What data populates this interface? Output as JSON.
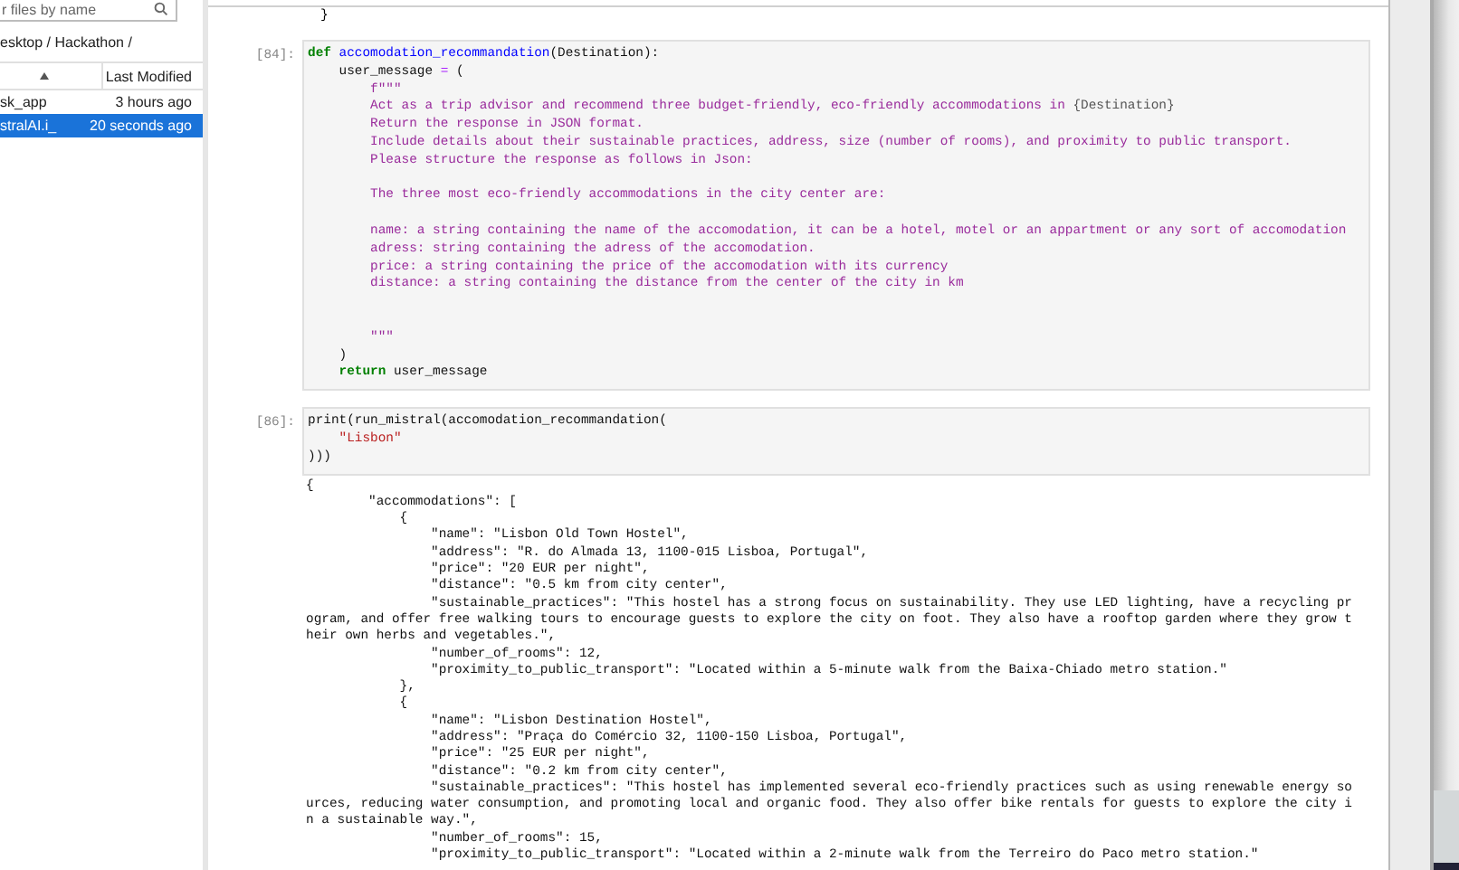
{
  "file_browser": {
    "search": {
      "placeholder": "r files by name"
    },
    "breadcrumb": "esktop / Hackathon /",
    "header": {
      "column_2": "Last Modified"
    },
    "files": [
      {
        "name": "sk_app",
        "modified": "3 hours ago",
        "selected": false
      },
      {
        "name": "stralAI.i_",
        "modified": "20 seconds ago",
        "selected": true
      }
    ]
  },
  "notebook": {
    "previous_output": [
      "}"
    ],
    "cells": [
      {
        "prompt": "[84]:",
        "lines": [
          {
            "kind": "code",
            "tokens": [
              {
                "kind": "keyword",
                "text": "def"
              },
              {
                "kind": "function",
                "text": " accomodation_recommandation"
              },
              {
                "kind": "plain",
                "text": "(Destination):"
              }
            ]
          },
          {
            "kind": "code",
            "tokens": [
              {
                "kind": "plain",
                "text": "    user_message "
              },
              {
                "kind": "operator",
                "text": "="
              },
              {
                "kind": "plain",
                "text": " ("
              }
            ]
          },
          {
            "kind": "code",
            "tokens": [
              {
                "kind": "docstring",
                "text": "        f\"\"\""
              }
            ]
          },
          {
            "kind": "code",
            "tokens": [
              {
                "kind": "docstring",
                "text": "        Act as a trip advisor and recommend three budget-friendly, eco-friendly accommodations in "
              },
              {
                "kind": "interp",
                "text": "{Destination}"
              }
            ]
          },
          {
            "kind": "code",
            "tokens": [
              {
                "kind": "docstring",
                "text": "        Return the response in JSON format."
              }
            ]
          },
          {
            "kind": "code",
            "tokens": [
              {
                "kind": "docstring",
                "text": "        Include details about their sustainable practices, address, size (number of rooms), and proximity to public transport."
              }
            ]
          },
          {
            "kind": "code",
            "tokens": [
              {
                "kind": "docstring",
                "text": "        Please structure the response as follows in Json:"
              }
            ]
          },
          {
            "kind": "blank"
          },
          {
            "kind": "code",
            "tokens": [
              {
                "kind": "docstring",
                "text": "        The three most eco-friendly accommodations in the city center are:"
              }
            ]
          },
          {
            "kind": "blank"
          },
          {
            "kind": "code",
            "tokens": [
              {
                "kind": "docstring",
                "text": "        name: a string containing the name of the accomodation, it can be a hotel, motel or an appartment or any sort of accomodation"
              }
            ]
          },
          {
            "kind": "code",
            "tokens": [
              {
                "kind": "docstring",
                "text": "        adress: string containing the adress of the accomodation."
              }
            ]
          },
          {
            "kind": "code",
            "tokens": [
              {
                "kind": "docstring",
                "text": "        price: a string containing the price of the accomodation with its currency"
              }
            ]
          },
          {
            "kind": "code",
            "tokens": [
              {
                "kind": "docstring",
                "text": "        distance: a string containing the distance from the center of the city in km"
              }
            ]
          },
          {
            "kind": "blank"
          },
          {
            "kind": "blank"
          },
          {
            "kind": "code",
            "tokens": [
              {
                "kind": "docstring",
                "text": "        \"\"\""
              }
            ]
          },
          {
            "kind": "code",
            "tokens": [
              {
                "kind": "plain",
                "text": "    )"
              }
            ]
          },
          {
            "kind": "code",
            "tokens": [
              {
                "kind": "keyword",
                "text": "    return"
              },
              {
                "kind": "plain",
                "text": " user_message"
              }
            ]
          }
        ]
      },
      {
        "prompt": "[86]:",
        "lines": [
          {
            "kind": "code",
            "tokens": [
              {
                "kind": "plain",
                "text": "print(run_mistral(accomodation_recommandation("
              }
            ]
          },
          {
            "kind": "code",
            "tokens": [
              {
                "kind": "string",
                "text": "    \"Lisbon\""
              }
            ]
          },
          {
            "kind": "code",
            "tokens": [
              {
                "kind": "plain",
                "text": ")))"
              }
            ]
          }
        ],
        "output": [
          "{",
          "        \"accommodations\": [",
          "            {",
          "                \"name\": \"Lisbon Old Town Hostel\",",
          "                \"address\": \"R. do Almada 13, 1100-015 Lisboa, Portugal\",",
          "                \"price\": \"20 EUR per night\",",
          "                \"distance\": \"0.5 km from city center\",",
          "                \"sustainable_practices\": \"This hostel has a strong focus on sustainability. They use LED lighting, have a recycling pr",
          "ogram, and offer free walking tours to encourage guests to explore the city on foot. They also have a rooftop garden where they grow t",
          "heir own herbs and vegetables.\",",
          "                \"number_of_rooms\": 12,",
          "                \"proximity_to_public_transport\": \"Located within a 5-minute walk from the Baixa-Chiado metro station.\"",
          "            },",
          "            {",
          "                \"name\": \"Lisbon Destination Hostel\",",
          "                \"address\": \"Praça do Comércio 32, 1100-150 Lisboa, Portugal\",",
          "                \"price\": \"25 EUR per night\",",
          "                \"distance\": \"0.2 km from city center\",",
          "                \"sustainable_practices\": \"This hostel has implemented several eco-friendly practices such as using renewable energy so",
          "urces, reducing water consumption, and promoting local and organic food. They also offer bike rentals for guests to explore the city i",
          "n a sustainable way.\",",
          "                \"number_of_rooms\": 15,",
          "                \"proximity_to_public_transport\": \"Located within a 2-minute walk from the Terreiro do Paco metro station.\""
        ]
      }
    ]
  }
}
